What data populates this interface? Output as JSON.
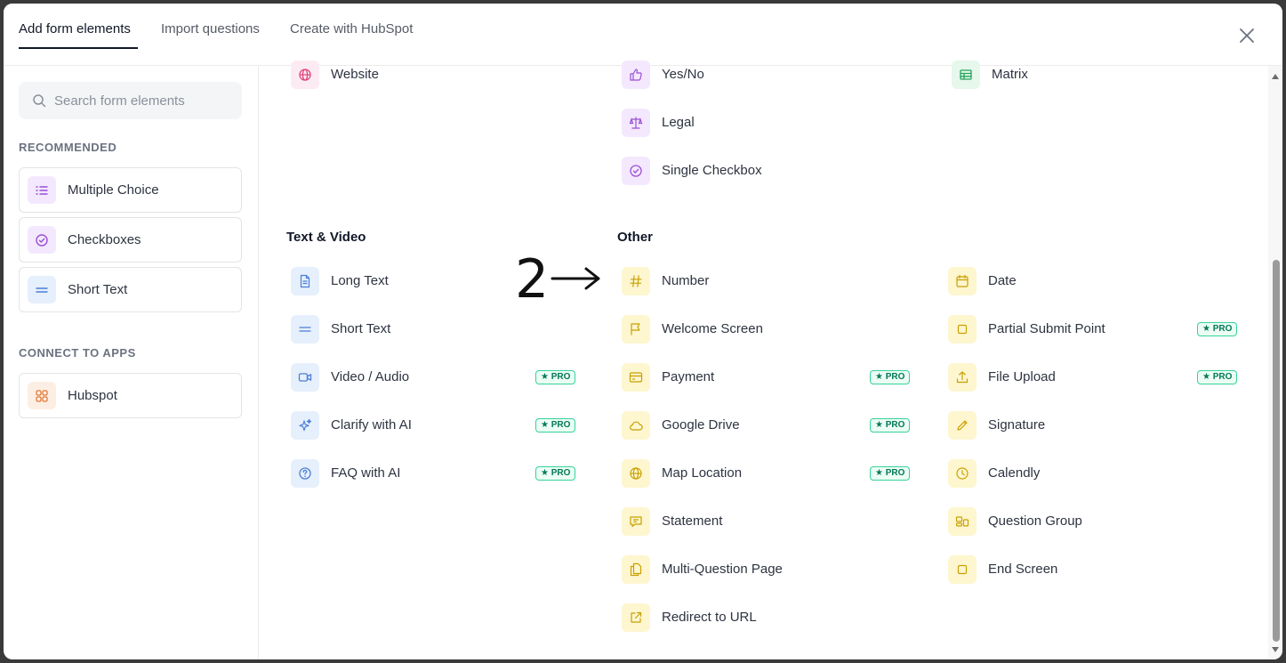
{
  "tabs": [
    {
      "label": "Add form elements"
    },
    {
      "label": "Import questions"
    },
    {
      "label": "Create with HubSpot"
    }
  ],
  "search": {
    "placeholder": "Search form elements"
  },
  "sidebar": {
    "recommended_heading": "RECOMMENDED",
    "recommended": [
      {
        "label": "Multiple Choice",
        "icon": "list-icon"
      },
      {
        "label": "Checkboxes",
        "icon": "check-circle-icon"
      },
      {
        "label": "Short Text",
        "icon": "equals-icon"
      }
    ],
    "apps_heading": "CONNECT TO APPS",
    "apps": [
      {
        "label": "Hubspot",
        "icon": "grid-icon"
      }
    ]
  },
  "pro_label": "★ PRO",
  "top_items": {
    "col1": [
      {
        "label": "Website",
        "icon": "globe-icon"
      }
    ],
    "col2": [
      {
        "label": "Yes/No",
        "icon": "thumbs-up-icon"
      },
      {
        "label": "Legal",
        "icon": "scale-icon"
      },
      {
        "label": "Single Checkbox",
        "icon": "check-circle-icon"
      }
    ],
    "col3": [
      {
        "label": "Matrix",
        "icon": "table-icon"
      }
    ]
  },
  "text_video": {
    "title": "Text & Video",
    "items": [
      {
        "label": "Long Text",
        "icon": "document-icon",
        "pro": false
      },
      {
        "label": "Short Text",
        "icon": "equals-icon",
        "pro": false
      },
      {
        "label": "Video / Audio",
        "icon": "video-icon",
        "pro": true
      },
      {
        "label": "Clarify with AI",
        "icon": "sparkle-icon",
        "pro": true
      },
      {
        "label": "FAQ with AI",
        "icon": "question-icon",
        "pro": true
      }
    ]
  },
  "other": {
    "title": "Other",
    "col1": [
      {
        "label": "Number",
        "icon": "hash-icon",
        "pro": false
      },
      {
        "label": "Welcome Screen",
        "icon": "flag-icon",
        "pro": false
      },
      {
        "label": "Payment",
        "icon": "card-icon",
        "pro": true
      },
      {
        "label": "Google Drive",
        "icon": "cloud-icon",
        "pro": true
      },
      {
        "label": "Map Location",
        "icon": "globe-icon",
        "pro": true
      },
      {
        "label": "Statement",
        "icon": "chat-icon",
        "pro": false
      },
      {
        "label": "Multi-Question Page",
        "icon": "pages-icon",
        "pro": false
      },
      {
        "label": "Redirect to URL",
        "icon": "external-link-icon",
        "pro": false
      }
    ],
    "col2": [
      {
        "label": "Date",
        "icon": "calendar-icon",
        "pro": false
      },
      {
        "label": "Partial Submit Point",
        "icon": "square-icon",
        "pro": true
      },
      {
        "label": "File Upload",
        "icon": "upload-icon",
        "pro": true
      },
      {
        "label": "Signature",
        "icon": "pencil-icon",
        "pro": false
      },
      {
        "label": "Calendly",
        "icon": "clock-icon",
        "pro": false
      },
      {
        "label": "Question Group",
        "icon": "group-icon",
        "pro": false
      },
      {
        "label": "End Screen",
        "icon": "square-icon",
        "pro": false
      }
    ]
  },
  "annotation": {
    "number": "2"
  },
  "colors": {
    "pink": "#e0457b",
    "purple": "#9b4fd6",
    "green": "#22a35a",
    "blue": "#4a7fd6",
    "yellow": "#c9a000",
    "orange": "#e07a3a"
  }
}
